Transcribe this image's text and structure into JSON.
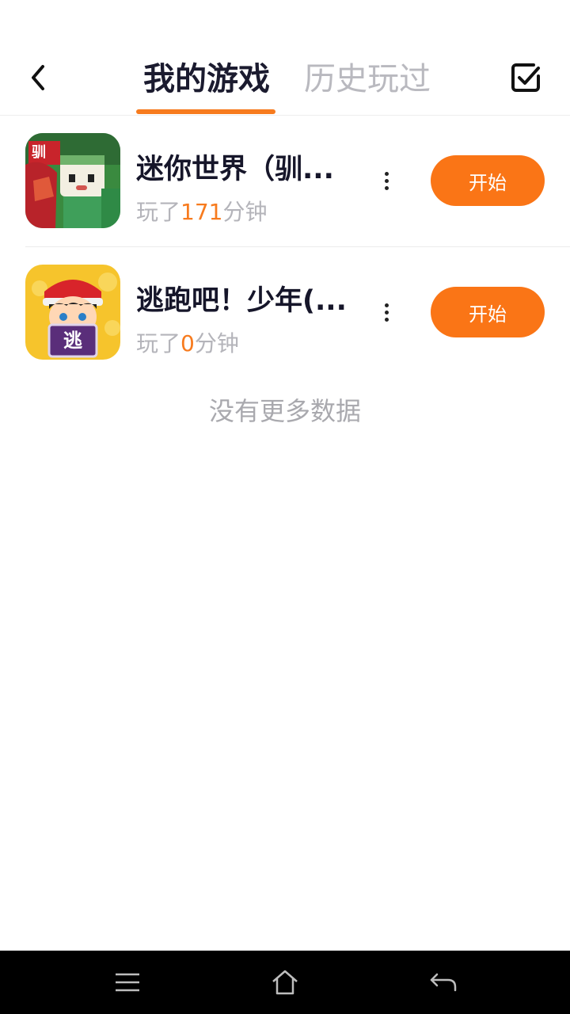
{
  "header": {
    "back_icon": "chevron-left-icon",
    "tabs": [
      {
        "label": "我的游戏",
        "active": true
      },
      {
        "label": "历史玩过",
        "active": false
      }
    ],
    "manage_icon": "checkbox-checked-icon",
    "accent_color": "#f77b1e"
  },
  "games": [
    {
      "title": "迷你世界（驯...",
      "played_prefix": "玩了",
      "played_minutes": "171",
      "played_suffix": "分钟",
      "start_label": "开始",
      "icon": "mini-world-game-icon"
    },
    {
      "title": "逃跑吧！少年(...",
      "played_prefix": "玩了",
      "played_minutes": "0",
      "played_suffix": "分钟",
      "start_label": "开始",
      "icon": "escape-boy-game-icon",
      "icon_text": "逃"
    }
  ],
  "footer_text": "没有更多数据",
  "navbar": {
    "icons": [
      "menu-icon",
      "home-icon",
      "back-arrow-icon"
    ]
  }
}
